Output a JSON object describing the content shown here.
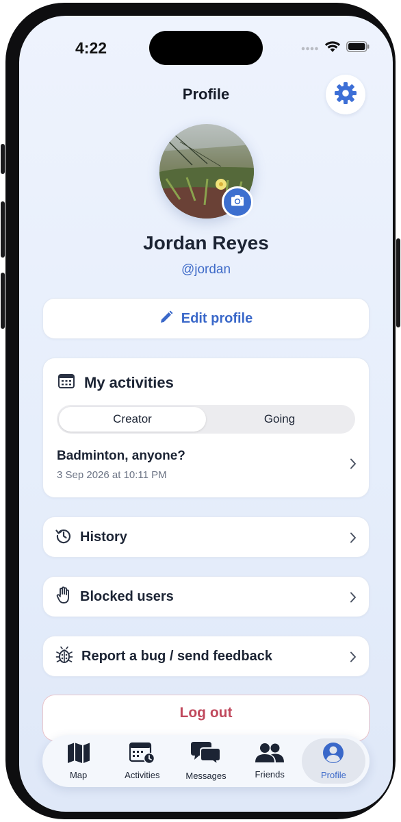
{
  "status_bar": {
    "time": "4:22"
  },
  "header": {
    "title": "Profile"
  },
  "profile": {
    "name": "Jordan Reyes",
    "handle": "@jordan"
  },
  "edit_profile": {
    "label": "Edit profile"
  },
  "my_activities": {
    "title": "My activities",
    "segments": [
      "Creator",
      "Going"
    ],
    "selected_segment": "Creator",
    "items": [
      {
        "title": "Badminton, anyone?",
        "subtitle": "3 Sep 2026 at 10:11 PM"
      }
    ]
  },
  "menu": [
    {
      "label": "History",
      "icon": "history-icon"
    },
    {
      "label": "Blocked users",
      "icon": "hand-icon"
    },
    {
      "label": "Report a bug / send feedback",
      "icon": "bug-icon"
    }
  ],
  "logout": {
    "label": "Log out"
  },
  "tabs": [
    {
      "label": "Map",
      "icon": "map-icon"
    },
    {
      "label": "Activities",
      "icon": "calendar-clock-icon"
    },
    {
      "label": "Messages",
      "icon": "chat-bubbles-icon"
    },
    {
      "label": "Friends",
      "icon": "people-icon"
    },
    {
      "label": "Profile",
      "icon": "person-circle-icon",
      "active": true
    }
  ],
  "colors": {
    "accent": "#3a68c9",
    "danger": "#c0485c",
    "background": "#eaf0fb"
  }
}
